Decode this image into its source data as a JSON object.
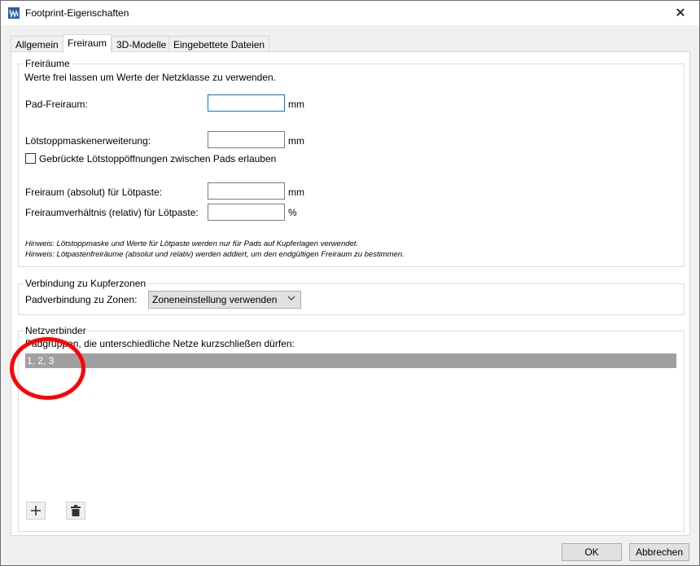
{
  "window": {
    "title": "Footprint-Eigenschaften",
    "close_glyph": "✕"
  },
  "tabs": [
    {
      "label": "Allgemein"
    },
    {
      "label": "Freiraum"
    },
    {
      "label": "3D-Modelle"
    },
    {
      "label": "Eingebettete Dateien"
    }
  ],
  "clearances": {
    "legend": "Freiräume",
    "intro": "Werte frei lassen um Werte der Netzklasse zu verwenden.",
    "pad_clearance_label": "Pad-Freiraum:",
    "pad_clearance_value": "",
    "pad_clearance_unit": "mm",
    "solder_mask_label": "Lötstoppmaskenerweiterung:",
    "solder_mask_value": "",
    "solder_mask_unit": "mm",
    "bridged_checkbox_label": "Gebrückte Lötstoppöffnungen zwischen Pads erlauben",
    "paste_abs_label": "Freiraum (absolut) für Lötpaste:",
    "paste_abs_value": "",
    "paste_abs_unit": "mm",
    "paste_rel_label": "Freiraumverhältnis (relativ) für Lötpaste:",
    "paste_rel_value": "",
    "paste_rel_unit": "%",
    "hint1": "Hinweis: Lötstoppmaske und Werte für Lötpaste werden nur für Pads auf Kupferlagen verwendet.",
    "hint2": "Hinweis: Lötpastenfreiräume (absolut und relativ) werden addiert, um den endgültigen Freiraum zu bestimmen."
  },
  "zones": {
    "legend": "Verbindung zu Kupferzonen",
    "pad_connection_label": "Padverbindung zu Zonen:",
    "pad_connection_value": "Zoneneinstellung verwenden"
  },
  "net_ties": {
    "legend": "Netzverbinder",
    "description": "Padgruppen, die unterschiedliche Netze kurzschließen dürfen:",
    "rows": [
      "1, 2, 3"
    ]
  },
  "buttons": {
    "ok": "OK",
    "cancel": "Abbrechen"
  },
  "icons": {
    "app": "kicad-footprint-icon",
    "close": "close-icon",
    "add": "plus-icon",
    "delete": "trash-icon",
    "dropdown": "chevron-down-icon"
  },
  "colors": {
    "accent": "#0078d7",
    "annotation": "#ff0000",
    "selected_row": "#a0a0a0"
  }
}
